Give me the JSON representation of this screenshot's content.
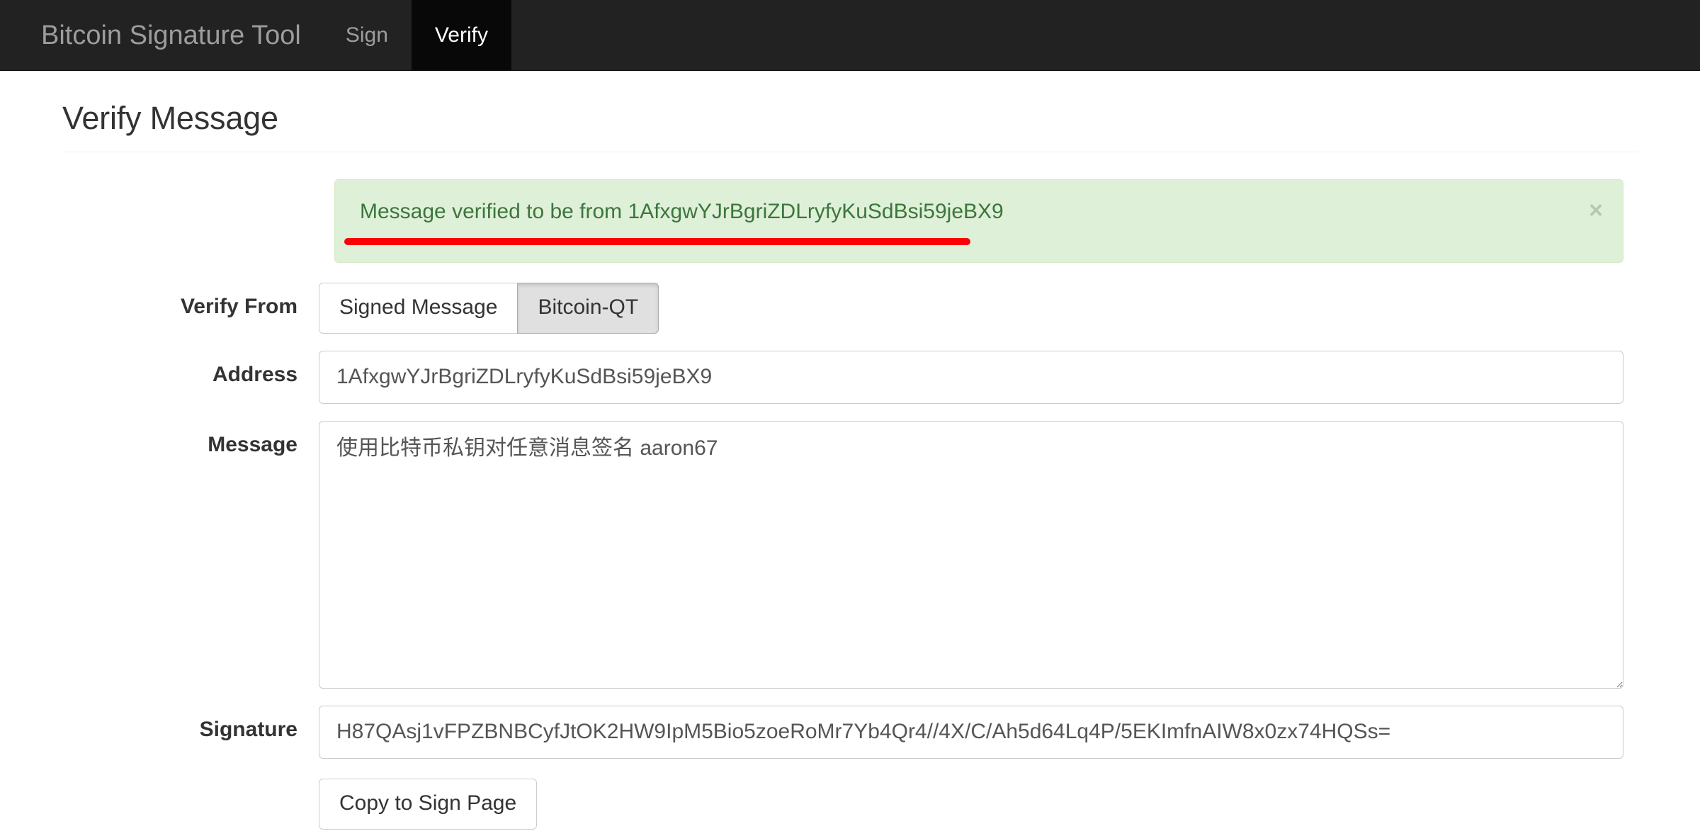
{
  "navbar": {
    "brand": "Bitcoin Signature Tool",
    "items": [
      {
        "label": "Sign",
        "active": false
      },
      {
        "label": "Verify",
        "active": true
      }
    ]
  },
  "page": {
    "title": "Verify Message"
  },
  "alert": {
    "type": "success",
    "message": "Message verified to be from 1AfxgwYJrBgriZDLryfyKuSdBsi59jeBX9",
    "close_label": "×",
    "background_color": "#dff0d8",
    "border_color": "#d6e9c6",
    "text_color": "#3c763d"
  },
  "annotation": {
    "underline_color": "#fb0007"
  },
  "form": {
    "verify_from": {
      "label": "Verify From",
      "options": [
        {
          "label": "Signed Message",
          "selected": false
        },
        {
          "label": "Bitcoin-QT",
          "selected": true
        }
      ]
    },
    "address": {
      "label": "Address",
      "value": "1AfxgwYJrBgriZDLryfyKuSdBsi59jeBX9",
      "placeholder": "Address"
    },
    "message": {
      "label": "Message",
      "value": "使用比特币私钥对任意消息签名 aaron67",
      "placeholder": "Message"
    },
    "signature": {
      "label": "Signature",
      "value": "H87QAsj1vFPZBNBCyfJtOK2HW9IpM5Bio5zoeRoMr7Yb4Qr4//4X/C/Ah5d64Lq4P/5EKImfnAIW8x0zx74HQSs=",
      "placeholder": "Signature"
    },
    "copy_button": {
      "label": "Copy to Sign Page"
    }
  }
}
